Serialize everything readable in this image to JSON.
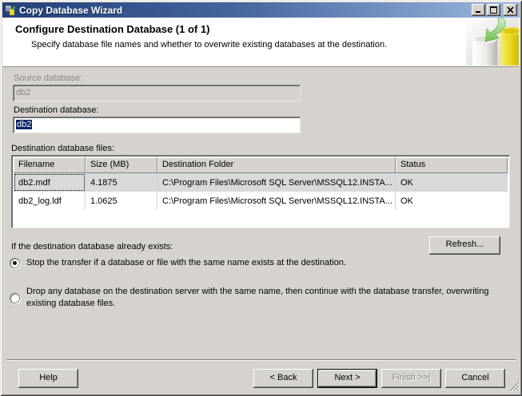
{
  "window": {
    "title": "Copy Database Wizard"
  },
  "header": {
    "title": "Configure Destination Database (1 of 1)",
    "subtitle": "Specify database file names and whether to overwrite existing databases at the destination."
  },
  "form": {
    "source_label": "Source database:",
    "source_value": "db2",
    "destination_label": "Destination database:",
    "destination_value": "db2",
    "files_label": "Destination database files:"
  },
  "table": {
    "columns": [
      "Filename",
      "Size (MB)",
      "Destination Folder",
      "Status"
    ],
    "rows": [
      {
        "filename": "db2.mdf",
        "size": "4.1875",
        "folder": "C:\\Program Files\\Microsoft SQL Server\\MSSQL12.INSTA...",
        "status": "OK",
        "selected": true
      },
      {
        "filename": "db2_log.ldf",
        "size": "1.0625",
        "folder": "C:\\Program Files\\Microsoft SQL Server\\MSSQL12.INSTA...",
        "status": "OK",
        "selected": false
      }
    ]
  },
  "options": {
    "exists_label": "If the destination database already exists:",
    "refresh_button": "Refresh...",
    "radios": [
      {
        "label": "Stop the transfer if a database or file with the same name exists at the destination.",
        "selected": true
      },
      {
        "label": "Drop any database on the destination server with the same name, then continue with the database transfer, overwriting existing database files.",
        "selected": false
      }
    ]
  },
  "footer": {
    "help": "Help",
    "back": "< Back",
    "next": "Next >",
    "finish": "Finish >>|",
    "cancel": "Cancel"
  },
  "colors": {
    "titlebar_left": "#24407a",
    "titlebar_right": "#9db8df",
    "selection": "#0a246a",
    "window_bg": "#d6d3ce",
    "banner_bg": "#ffffff",
    "row_selected_bg": "#d9d9d9"
  }
}
